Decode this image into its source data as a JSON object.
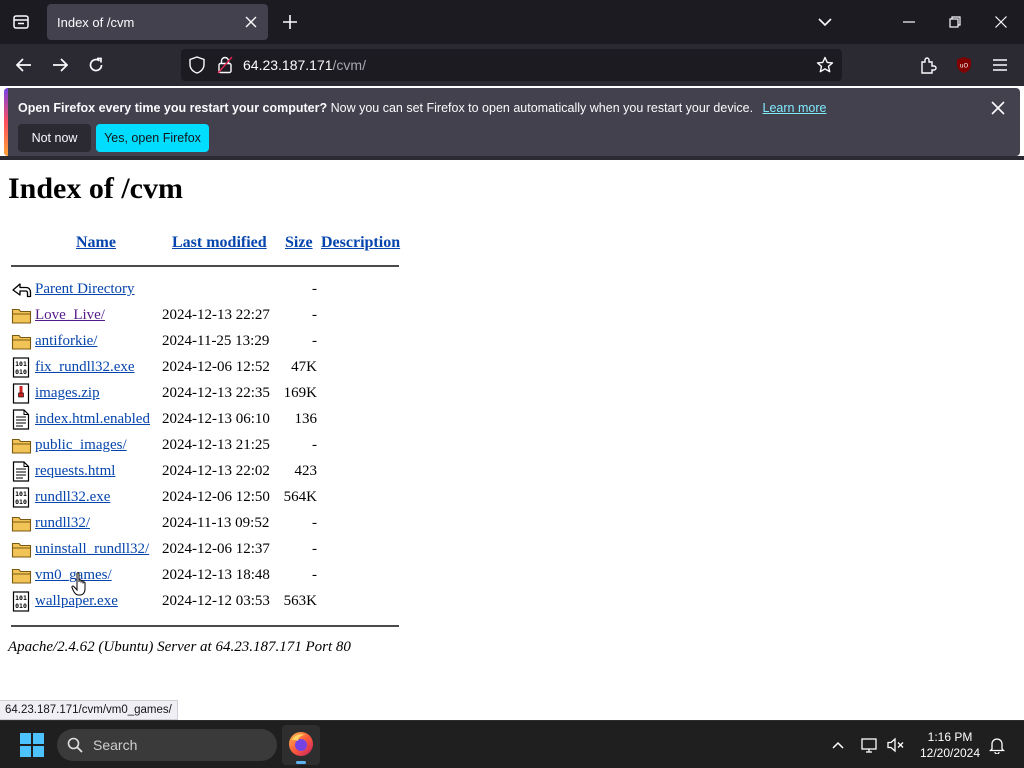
{
  "browser": {
    "tab_title": "Index of /cvm",
    "url_host": "64.23.187.171",
    "url_path": "/cvm/"
  },
  "notification": {
    "bold_text": "Open Firefox every time you restart your computer?",
    "body_text": "Now you can set Firefox to open automatically when you restart your device.",
    "link_text": "Learn more",
    "not_now_label": "Not now",
    "yes_label": "Yes, open Firefox"
  },
  "page": {
    "title": "Index of /cvm",
    "columns": {
      "name": "Name",
      "modified": "Last modified",
      "size": "Size",
      "description": "Description"
    },
    "rows": [
      {
        "icon": "back-icon",
        "name": "Parent Directory",
        "modified": "",
        "size": "-"
      },
      {
        "icon": "folder-icon",
        "name": "Love_Live/",
        "modified": "2024-12-13 22:27",
        "size": "-"
      },
      {
        "icon": "folder-icon",
        "name": "antiforkie/",
        "modified": "2024-11-25 13:29",
        "size": "-"
      },
      {
        "icon": "binary-icon",
        "name": "fix_rundll32.exe",
        "modified": "2024-12-06 12:52",
        "size": "47K"
      },
      {
        "icon": "archive-icon",
        "name": "images.zip",
        "modified": "2024-12-13 22:35",
        "size": "169K"
      },
      {
        "icon": "text-icon",
        "name": "index.html.enabled",
        "modified": "2024-12-13 06:10",
        "size": "136"
      },
      {
        "icon": "folder-icon",
        "name": "public_images/",
        "modified": "2024-12-13 21:25",
        "size": "-"
      },
      {
        "icon": "text-icon",
        "name": "requests.html",
        "modified": "2024-12-13 22:02",
        "size": "423"
      },
      {
        "icon": "binary-icon",
        "name": "rundll32.exe",
        "modified": "2024-12-06 12:50",
        "size": "564K"
      },
      {
        "icon": "folder-icon",
        "name": "rundll32/",
        "modified": "2024-11-13 09:52",
        "size": "-"
      },
      {
        "icon": "folder-icon",
        "name": "uninstall_rundll32/",
        "modified": "2024-12-06 12:37",
        "size": "-"
      },
      {
        "icon": "folder-icon",
        "name": "vm0_games/",
        "modified": "2024-12-13 18:48",
        "size": "-"
      },
      {
        "icon": "binary-icon",
        "name": "wallpaper.exe",
        "modified": "2024-12-12 03:53",
        "size": "563K"
      }
    ],
    "server_signature": "Apache/2.4.62 (Ubuntu) Server at 64.23.187.171 Port 80"
  },
  "status_bar": {
    "url": "64.23.187.171/cvm/vm0_games/"
  },
  "taskbar": {
    "search_label": "Search",
    "time": "1:16 PM",
    "date": "12/20/2024"
  },
  "colors": {
    "tabbar_bg": "#1c1b22",
    "navbar_bg": "#2b2a33",
    "notification_bg": "#42414d",
    "primary_button": "#00ddff",
    "link": "#0645ad",
    "visited_link": "#551a8b"
  }
}
